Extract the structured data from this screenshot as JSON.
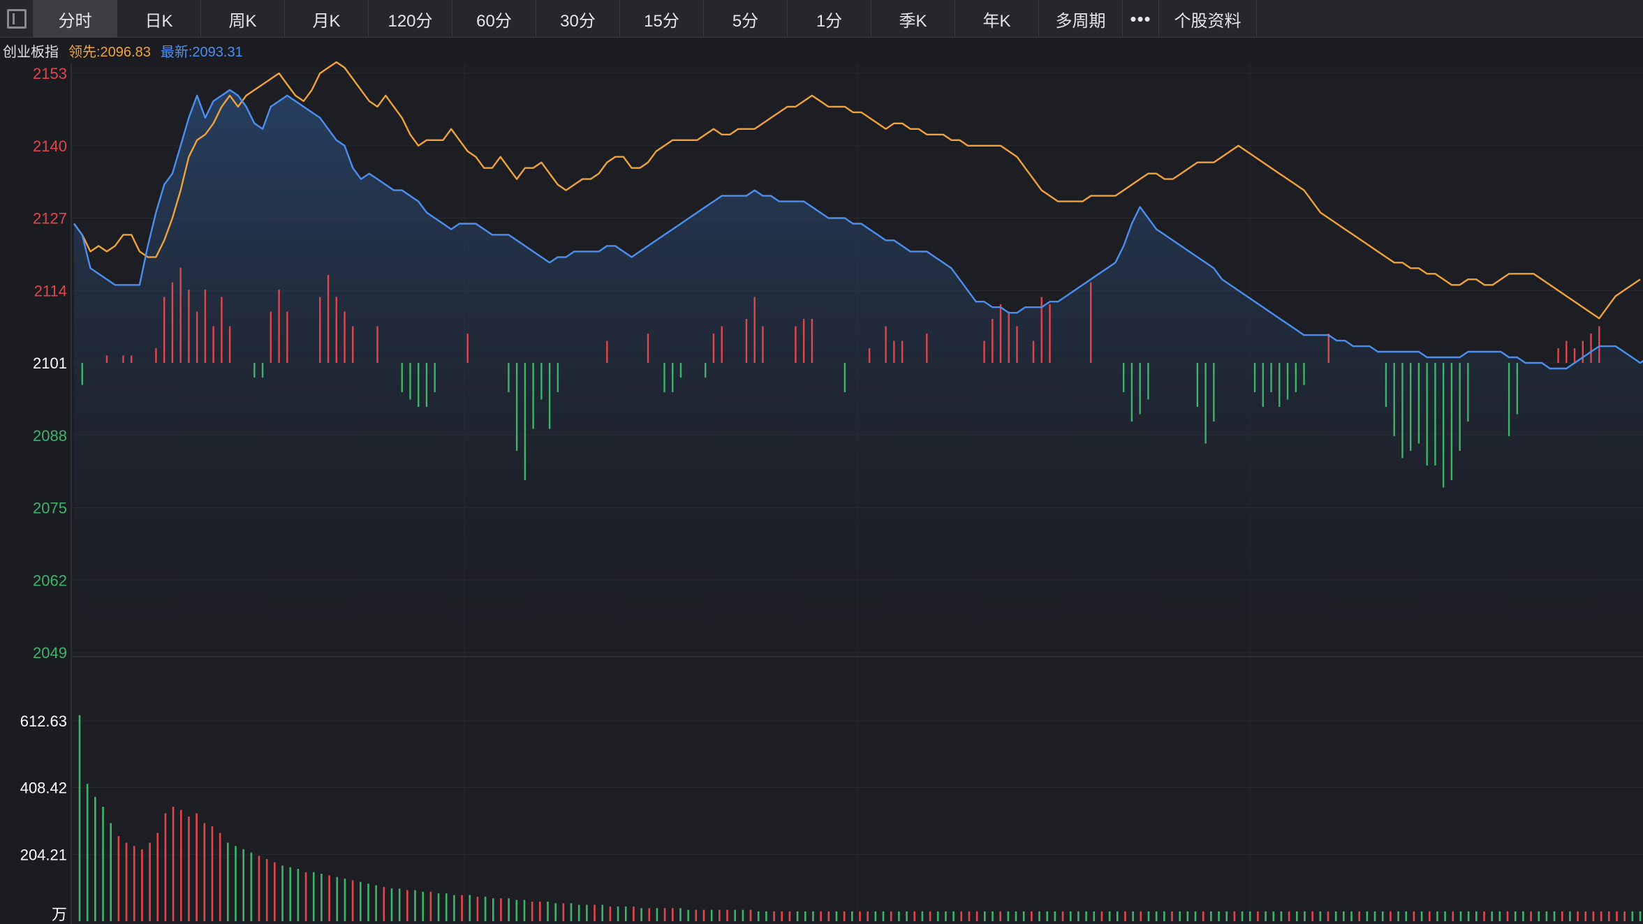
{
  "toolbar": {
    "tabs": [
      "分时",
      "日K",
      "周K",
      "月K",
      "120分",
      "60分",
      "30分",
      "15分",
      "5分",
      "1分",
      "季K",
      "年K",
      "多周期"
    ],
    "active": "分时",
    "more": "•••",
    "info": "个股资料"
  },
  "legend": {
    "name": "创业板指",
    "leading_label": "领先:2096.83",
    "latest_label": "最新:2093.31"
  },
  "colors": {
    "up": "#e0474d",
    "down": "#3db46a",
    "leading": "#f0a33a",
    "latest": "#4c8ff0",
    "bg": "#1b1c21"
  },
  "chart_data": {
    "type": "line",
    "price_axis": {
      "ticks": [
        2153,
        2140,
        2127,
        2114,
        2101,
        2088,
        2075,
        2062,
        2049
      ],
      "base": 2101,
      "ylim": [
        2049,
        2153
      ]
    },
    "volume_axis": {
      "ticks": [
        "612.63",
        "408.42",
        "204.21"
      ],
      "unit": "万",
      "ylim": [
        0,
        800
      ]
    },
    "series": [
      {
        "name": "领先",
        "values": [
          2126,
          2124,
          2121,
          2122,
          2121,
          2122,
          2124,
          2124,
          2121,
          2120,
          2120,
          2123,
          2127,
          2132,
          2138,
          2141,
          2142,
          2144,
          2147,
          2149,
          2147,
          2149,
          2150,
          2151,
          2152,
          2153,
          2151,
          2149,
          2148,
          2150,
          2153,
          2154,
          2155,
          2154,
          2152,
          2150,
          2148,
          2147,
          2149,
          2147,
          2145,
          2142,
          2140,
          2141,
          2141,
          2141,
          2143,
          2141,
          2139,
          2138,
          2136,
          2136,
          2138,
          2136,
          2134,
          2136,
          2136,
          2137,
          2135,
          2133,
          2132,
          2133,
          2134,
          2134,
          2135,
          2137,
          2138,
          2138,
          2136,
          2136,
          2137,
          2139,
          2140,
          2141,
          2141,
          2141,
          2141,
          2142,
          2143,
          2142,
          2142,
          2143,
          2143,
          2143,
          2144,
          2145,
          2146,
          2147,
          2147,
          2148,
          2149,
          2148,
          2147,
          2147,
          2147,
          2146,
          2146,
          2145,
          2144,
          2143,
          2144,
          2144,
          2143,
          2143,
          2142,
          2142,
          2142,
          2141,
          2141,
          2140,
          2140,
          2140,
          2140,
          2140,
          2139,
          2138,
          2136,
          2134,
          2132,
          2131,
          2130,
          2130,
          2130,
          2130,
          2131,
          2131,
          2131,
          2131,
          2132,
          2133,
          2134,
          2135,
          2135,
          2134,
          2134,
          2135,
          2136,
          2137,
          2137,
          2137,
          2138,
          2139,
          2140,
          2139,
          2138,
          2137,
          2136,
          2135,
          2134,
          2133,
          2132,
          2130,
          2128,
          2127,
          2126,
          2125,
          2124,
          2123,
          2122,
          2121,
          2120,
          2119,
          2119,
          2118,
          2118,
          2117,
          2117,
          2116,
          2115,
          2115,
          2116,
          2116,
          2115,
          2115,
          2116,
          2117,
          2117,
          2117,
          2117,
          2116,
          2115,
          2114,
          2113,
          2112,
          2111,
          2110,
          2109,
          2111,
          2113,
          2114,
          2115,
          2116
        ],
        "color": "#f0a33a"
      },
      {
        "name": "最新",
        "values": [
          2126,
          2124,
          2118,
          2117,
          2116,
          2115,
          2115,
          2115,
          2115,
          2122,
          2128,
          2133,
          2135,
          2140,
          2145,
          2149,
          2145,
          2148,
          2149,
          2150,
          2149,
          2147,
          2144,
          2143,
          2147,
          2148,
          2149,
          2148,
          2147,
          2146,
          2145,
          2143,
          2141,
          2140,
          2136,
          2134,
          2135,
          2134,
          2133,
          2132,
          2132,
          2131,
          2130,
          2128,
          2127,
          2126,
          2125,
          2126,
          2126,
          2126,
          2125,
          2124,
          2124,
          2124,
          2123,
          2122,
          2121,
          2120,
          2119,
          2120,
          2120,
          2121,
          2121,
          2121,
          2121,
          2122,
          2122,
          2121,
          2120,
          2121,
          2122,
          2123,
          2124,
          2125,
          2126,
          2127,
          2128,
          2129,
          2130,
          2131,
          2131,
          2131,
          2131,
          2132,
          2131,
          2131,
          2130,
          2130,
          2130,
          2130,
          2129,
          2128,
          2127,
          2127,
          2127,
          2126,
          2126,
          2125,
          2124,
          2123,
          2123,
          2122,
          2121,
          2121,
          2121,
          2120,
          2119,
          2118,
          2116,
          2114,
          2112,
          2112,
          2111,
          2111,
          2110,
          2110,
          2111,
          2111,
          2111,
          2112,
          2112,
          2113,
          2114,
          2115,
          2116,
          2117,
          2118,
          2119,
          2122,
          2126,
          2129,
          2127,
          2125,
          2124,
          2123,
          2122,
          2121,
          2120,
          2119,
          2118,
          2116,
          2115,
          2114,
          2113,
          2112,
          2111,
          2110,
          2109,
          2108,
          2107,
          2106,
          2106,
          2106,
          2106,
          2105,
          2105,
          2104,
          2104,
          2104,
          2103,
          2103,
          2103,
          2103,
          2103,
          2103,
          2102,
          2102,
          2102,
          2102,
          2102,
          2103,
          2103,
          2103,
          2103,
          2103,
          2102,
          2102,
          2101,
          2101,
          2101,
          2100,
          2100,
          2100,
          2101,
          2102,
          2103,
          2104,
          2104,
          2104,
          2103,
          2102,
          2101,
          2102,
          2103,
          2104
        ],
        "color": "#4c8ff0"
      }
    ],
    "diff_bars": [
      0,
      -3,
      0,
      0,
      1,
      0,
      1,
      1,
      0,
      0,
      2,
      9,
      11,
      13,
      10,
      7,
      10,
      5,
      9,
      5,
      0,
      0,
      -2,
      -2,
      7,
      10,
      7,
      0,
      0,
      0,
      9,
      12,
      9,
      7,
      5,
      0,
      0,
      5,
      0,
      0,
      -4,
      -5,
      -6,
      -6,
      -4,
      0,
      0,
      0,
      4,
      0,
      0,
      0,
      0,
      -4,
      -12,
      -16,
      -9,
      -5,
      -9,
      -4,
      0,
      0,
      0,
      0,
      0,
      3,
      0,
      0,
      0,
      0,
      4,
      0,
      -4,
      -4,
      -2,
      0,
      0,
      -2,
      4,
      5,
      0,
      0,
      6,
      9,
      5,
      0,
      0,
      0,
      5,
      6,
      6,
      0,
      0,
      0,
      -4,
      0,
      0,
      2,
      0,
      5,
      3,
      3,
      0,
      0,
      4,
      0,
      0,
      0,
      0,
      0,
      0,
      3,
      6,
      8,
      7,
      5,
      0,
      3,
      9,
      8,
      0,
      0,
      0,
      0,
      11,
      0,
      0,
      0,
      -4,
      -8,
      -7,
      -5,
      0,
      0,
      0,
      0,
      0,
      -6,
      -11,
      -8,
      0,
      0,
      0,
      0,
      -4,
      -6,
      -4,
      -6,
      -5,
      -4,
      -3,
      0,
      0,
      4,
      0,
      0,
      0,
      0,
      0,
      0,
      -6,
      -10,
      -13,
      -12,
      -11,
      -14,
      -14,
      -17,
      -16,
      -12,
      -8,
      0,
      0,
      0,
      0,
      -10,
      -7,
      0,
      0,
      0,
      0,
      2,
      3,
      2,
      3,
      4,
      5,
      0,
      0,
      0,
      0,
      0,
      0,
      -5,
      -6,
      -7
    ],
    "volume": [
      630,
      420,
      380,
      350,
      300,
      260,
      240,
      230,
      220,
      240,
      270,
      330,
      350,
      340,
      320,
      330,
      300,
      290,
      270,
      240,
      230,
      220,
      210,
      200,
      190,
      180,
      170,
      165,
      160,
      150,
      150,
      145,
      140,
      135,
      130,
      125,
      120,
      115,
      110,
      105,
      100,
      100,
      95,
      95,
      90,
      90,
      85,
      85,
      80,
      80,
      80,
      75,
      75,
      70,
      70,
      70,
      65,
      65,
      60,
      60,
      60,
      55,
      55,
      55,
      50,
      50,
      50,
      50,
      45,
      45,
      45,
      45,
      40,
      40,
      40,
      40,
      40,
      40,
      35,
      35,
      35,
      35,
      35,
      35,
      35,
      35,
      35,
      30,
      30,
      30,
      30,
      30,
      30,
      30,
      30,
      30,
      30,
      30,
      30,
      30,
      30,
      30,
      30,
      30,
      30,
      30,
      30,
      30,
      30,
      30,
      30,
      30,
      30,
      30,
      30,
      30,
      30,
      30,
      30,
      30,
      30,
      30,
      30,
      30,
      30,
      30,
      30,
      30,
      30,
      30,
      30,
      30,
      30,
      30,
      30,
      30,
      30,
      30,
      30,
      30,
      30,
      30,
      30,
      30,
      30,
      30,
      30,
      30,
      30,
      30,
      30,
      30,
      30,
      30,
      30,
      30,
      30,
      30,
      30,
      30,
      30,
      30,
      30,
      30,
      30,
      30,
      30,
      30,
      30,
      30,
      30,
      30,
      30,
      30,
      30,
      30,
      30,
      30,
      30,
      30,
      30,
      30,
      30,
      30,
      30,
      30,
      30,
      30,
      30,
      30,
      30,
      30,
      30,
      30,
      30,
      30,
      30,
      30,
      30,
      30,
      30
    ],
    "volume_up": [
      0,
      0,
      0,
      0,
      0,
      1,
      1,
      1,
      1,
      1,
      1,
      1,
      1,
      1,
      1,
      1,
      1,
      1,
      1,
      0,
      0,
      0,
      0,
      1,
      1,
      1,
      0,
      0,
      0,
      1,
      0,
      0,
      1,
      0,
      0,
      1,
      0,
      0,
      0,
      1,
      0,
      0,
      1,
      0,
      0,
      1,
      0,
      0,
      0,
      1,
      0,
      1,
      0,
      0,
      1,
      0,
      0,
      0,
      1,
      1,
      0,
      0,
      1,
      0,
      0,
      0,
      1,
      0,
      1,
      0,
      0,
      1,
      0,
      1,
      0,
      1,
      1,
      0,
      0,
      1,
      1,
      0,
      1,
      1,
      0,
      0,
      1,
      0,
      0,
      1,
      1,
      1,
      0,
      0,
      0,
      1,
      1,
      0,
      1,
      0,
      1,
      1,
      0,
      0,
      1,
      0,
      0,
      1,
      0,
      1,
      0,
      0,
      0,
      1,
      1,
      1,
      0,
      0,
      1,
      0,
      0,
      0,
      1,
      0,
      0,
      0,
      1,
      0,
      0,
      0,
      0,
      1,
      0,
      0,
      1,
      0,
      1,
      0,
      0,
      0,
      1,
      0,
      0,
      0,
      1,
      0,
      0,
      0,
      1,
      0,
      0,
      1,
      0,
      0,
      0,
      1,
      0,
      0,
      1,
      0,
      1,
      0,
      0,
      0,
      1,
      0,
      0,
      0,
      1,
      0,
      0,
      1,
      0,
      1,
      0,
      0,
      1,
      0,
      0,
      0,
      1,
      0,
      0,
      1,
      0,
      0,
      1,
      0,
      0,
      0,
      1,
      0,
      1,
      1,
      1,
      1,
      1,
      1,
      1
    ]
  }
}
